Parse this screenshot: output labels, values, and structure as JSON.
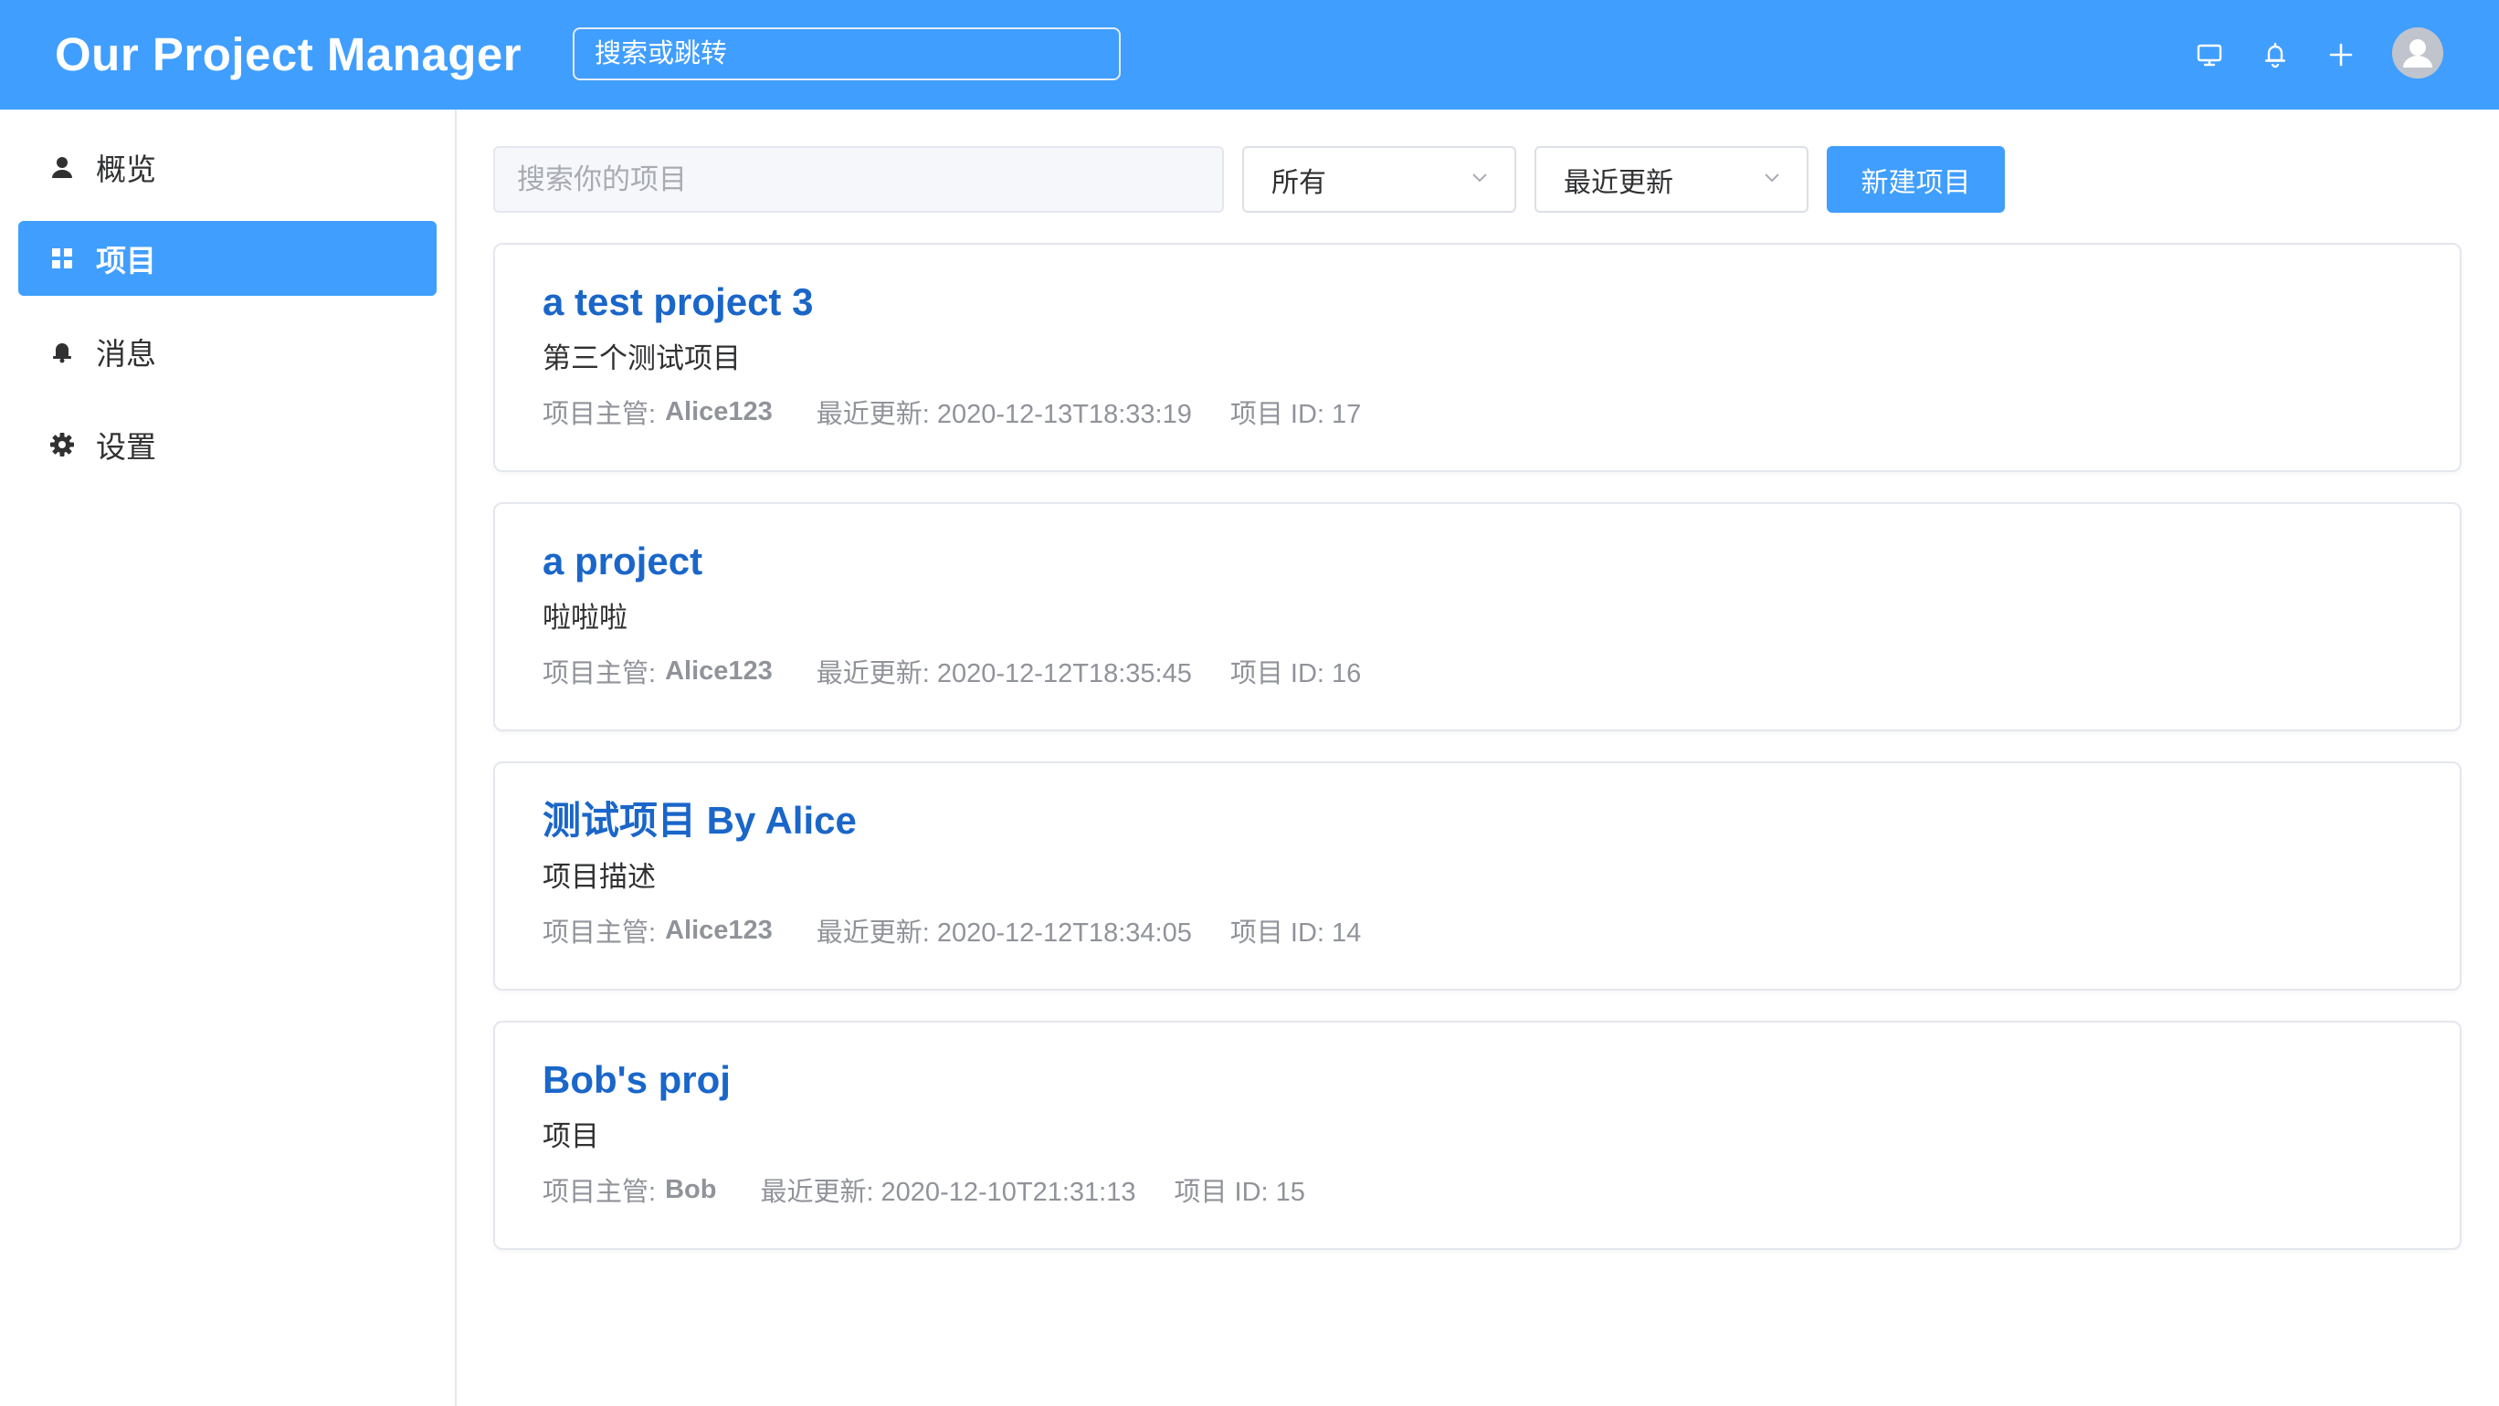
{
  "header": {
    "title": "Our Project Manager",
    "search_placeholder": "搜索或跳转",
    "icons": [
      "monitor-icon",
      "bell-icon",
      "plus-icon",
      "user-avatar"
    ]
  },
  "sidebar": {
    "items": [
      {
        "label": "概览",
        "icon": "user-icon",
        "active": false
      },
      {
        "label": "项目",
        "icon": "grid-icon",
        "active": true
      },
      {
        "label": "消息",
        "icon": "bell-icon",
        "active": false
      },
      {
        "label": "设置",
        "icon": "gear-icon",
        "active": false
      }
    ]
  },
  "toolbar": {
    "search_placeholder": "搜索你的项目",
    "filter_value": "所有",
    "sort_value": "最近更新",
    "new_button": "新建项目"
  },
  "projects": [
    {
      "title": "a test project 3",
      "description": "第三个测试项目",
      "owner_label": "项目主管:",
      "owner": "Alice123",
      "updated": "最近更新: 2020-12-13T18:33:19",
      "id": "项目 ID: 17"
    },
    {
      "title": "a project",
      "description": "啦啦啦",
      "owner_label": "项目主管:",
      "owner": "Alice123",
      "updated": "最近更新: 2020-12-12T18:35:45",
      "id": "项目 ID: 16"
    },
    {
      "title": "测试项目 By Alice",
      "description": "项目描述",
      "owner_label": "项目主管:",
      "owner": "Alice123",
      "updated": "最近更新: 2020-12-12T18:34:05",
      "id": "项目 ID: 14"
    },
    {
      "title": "Bob's proj",
      "description": "项目",
      "owner_label": "项目主管:",
      "owner": "Bob",
      "updated": "最近更新: 2020-12-10T21:31:13",
      "id": "项目 ID: 15"
    }
  ],
  "colors": {
    "primary": "#409eff",
    "title_link": "#1a66c9",
    "meta_text": "#909399",
    "border": "#e4e7ed"
  }
}
